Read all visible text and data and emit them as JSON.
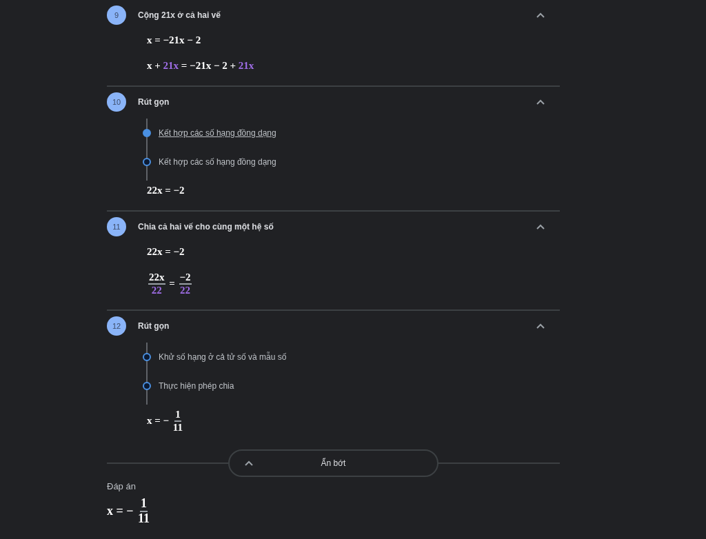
{
  "steps": [
    {
      "number": "9",
      "title": "Cộng **21x** ở cả hai vế",
      "expanded": true,
      "equations": [
        [
          {
            "kind": "text",
            "text": "x = −21x − 2",
            "highlight": false
          }
        ],
        [
          {
            "kind": "text",
            "text": "x + ",
            "highlight": false
          },
          {
            "kind": "text",
            "text": "21x",
            "highlight": true
          },
          {
            "kind": "text",
            "text": " = −21x − 2 + ",
            "highlight": false
          },
          {
            "kind": "text",
            "text": "21x",
            "highlight": true
          }
        ]
      ]
    },
    {
      "number": "10",
      "title": "Rút gọn",
      "expanded": true,
      "substeps": [
        {
          "text": "Kết hợp các số hạng đồng dạng",
          "selected": true
        },
        {
          "text": "Kết hợp các số hạng đồng dạng",
          "selected": false
        }
      ],
      "result": [
        {
          "kind": "text",
          "text": "22x = −2",
          "highlight": false
        }
      ]
    },
    {
      "number": "11",
      "title": "Chia cả hai vế cho cùng một hệ số",
      "expanded": true,
      "equations": [
        [
          {
            "kind": "text",
            "text": "22x = −2",
            "highlight": false
          }
        ],
        [
          {
            "kind": "frac",
            "num": [
              {
                "kind": "text",
                "text": "22x",
                "highlight": false
              }
            ],
            "den": [
              {
                "kind": "text",
                "text": "22",
                "highlight": true
              }
            ]
          },
          {
            "kind": "text",
            "text": " = ",
            "highlight": false
          },
          {
            "kind": "frac",
            "num": [
              {
                "kind": "text",
                "text": "−2",
                "highlight": false
              }
            ],
            "den": [
              {
                "kind": "text",
                "text": "22",
                "highlight": true
              }
            ]
          }
        ]
      ]
    },
    {
      "number": "12",
      "title": "Rút gọn",
      "expanded": true,
      "substeps": [
        {
          "text": "Khử số hạng ở cả tử số và mẫu số",
          "selected": false
        },
        {
          "text": "Thực hiện phép chia",
          "selected": false
        }
      ],
      "result": [
        {
          "kind": "text",
          "text": "x = − ",
          "highlight": false
        },
        {
          "kind": "frac",
          "num": [
            {
              "kind": "text",
              "text": "1",
              "highlight": false
            }
          ],
          "den": [
            {
              "kind": "text",
              "text": "11",
              "highlight": false
            }
          ]
        }
      ]
    }
  ],
  "collapse_button": {
    "label": "Ẩn bớt"
  },
  "answer": {
    "label": "Đáp án",
    "equation": [
      {
        "kind": "text",
        "text": "x = − ",
        "highlight": false
      },
      {
        "kind": "frac",
        "num": [
          {
            "kind": "text",
            "text": "1",
            "highlight": false
          }
        ],
        "den": [
          {
            "kind": "text",
            "text": "11",
            "highlight": false
          }
        ]
      }
    ]
  }
}
